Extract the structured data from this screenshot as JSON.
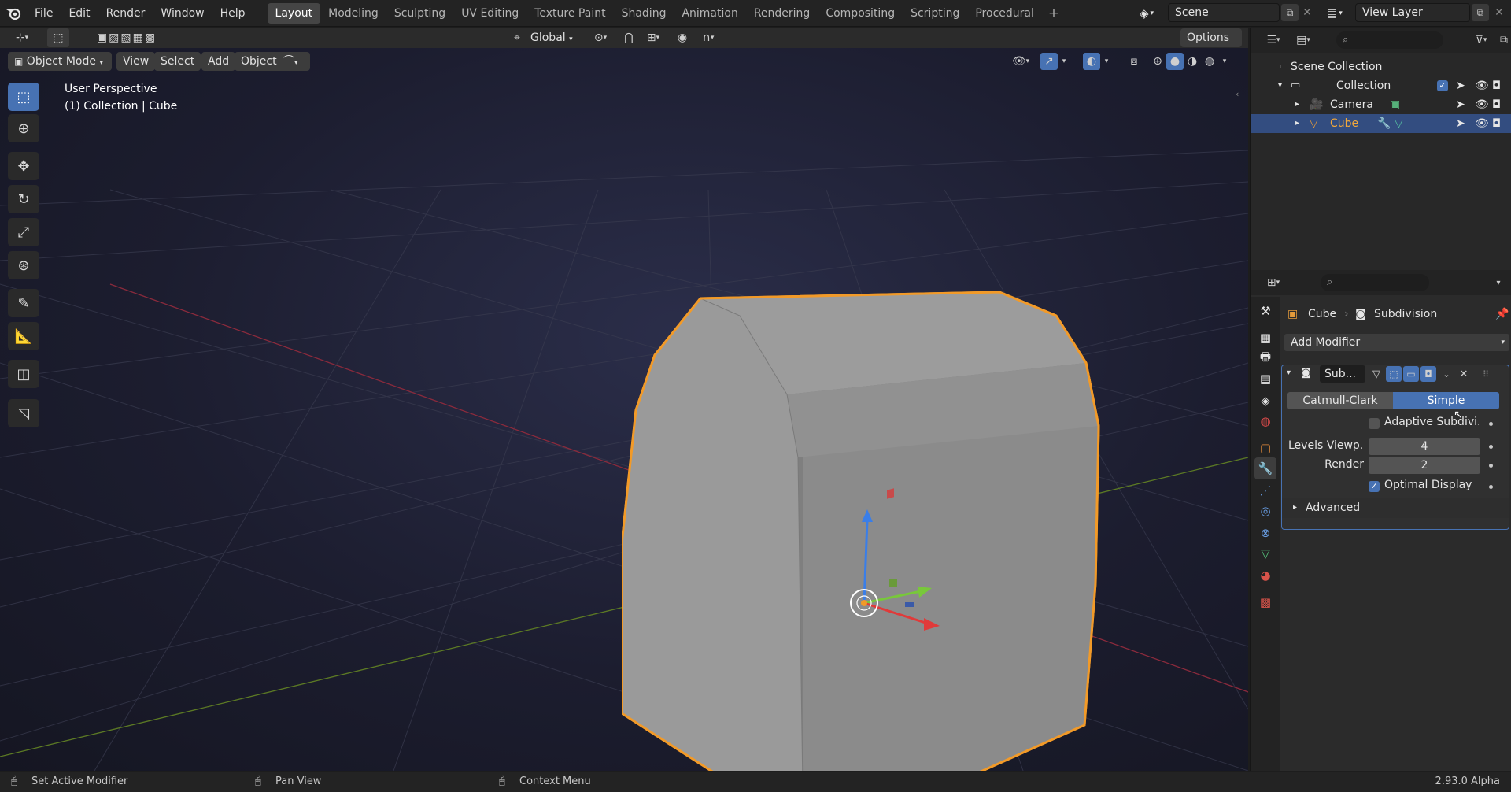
{
  "topbar": {
    "menus": [
      "File",
      "Edit",
      "Render",
      "Window",
      "Help"
    ],
    "workspaces": [
      "Layout",
      "Modeling",
      "Sculpting",
      "UV Editing",
      "Texture Paint",
      "Shading",
      "Animation",
      "Rendering",
      "Compositing",
      "Scripting",
      "Procedural"
    ],
    "active_workspace": "Layout",
    "scene": "Scene",
    "view_layer": "View Layer"
  },
  "toolheader": {
    "orientation": "Global",
    "options": "Options"
  },
  "viewport_header": {
    "mode": "Object Mode",
    "menus": [
      "View",
      "Select",
      "Add",
      "Object"
    ]
  },
  "viewport": {
    "perspective": "User Perspective",
    "collection_info": "(1) Collection | Cube"
  },
  "outliner": {
    "root": "Scene Collection",
    "collection": "Collection",
    "items": [
      {
        "name": "Camera",
        "selected": false
      },
      {
        "name": "Cube",
        "selected": true
      }
    ]
  },
  "properties": {
    "breadcrumb_object": "Cube",
    "breadcrumb_modifier": "Subdivision",
    "add_modifier": "Add Modifier",
    "modifier_name": "Sub...",
    "type_options": [
      "Catmull-Clark",
      "Simple"
    ],
    "active_type": "Simple",
    "adaptive_label": "Adaptive Subdivi...",
    "levels_viewport_label": "Levels Viewp...",
    "levels_viewport_value": "4",
    "render_label": "Render",
    "render_value": "2",
    "optimal_display_label": "Optimal Display",
    "advanced_label": "Advanced"
  },
  "statusbar": {
    "left_action": "Set Active Modifier",
    "middle_action": "Pan View",
    "right_action": "Context Menu",
    "version": "2.93.0 Alpha"
  },
  "colors": {
    "accent": "#4772b3",
    "selection_outline": "#f29a28",
    "viewport_bg": "#1c1d2f"
  }
}
